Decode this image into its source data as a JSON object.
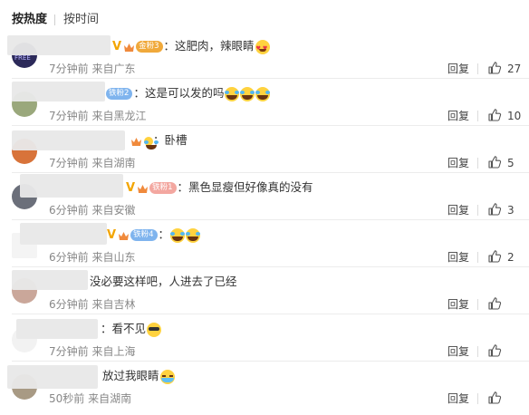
{
  "tabs": {
    "hot": "按热度",
    "time": "按时间"
  },
  "actions": {
    "reply": "回复"
  },
  "comments": [
    {
      "badge_prefix": "金粉",
      "badge_level": "3",
      "separator": "：",
      "text": "这肥肉，辣眼睛",
      "emojis": [
        "heart-eyes-emoji"
      ],
      "time": "7分钟前",
      "location": "来自广东",
      "likes": "27",
      "avatar_text": "FREE"
    },
    {
      "badge_prefix": "铁粉",
      "badge_level": "2",
      "separator": "：",
      "text": "这是可以发的吗",
      "emojis": [
        "laugh-cry-emoji",
        "laugh-cry-emoji",
        "laugh-cry-emoji"
      ],
      "time": "7分钟前",
      "location": "来自黑龙江",
      "likes": "10"
    },
    {
      "separator": "：",
      "text": "卧槽",
      "emojis": [],
      "time": "7分钟前",
      "location": "来自湖南",
      "likes": "5"
    },
    {
      "badge_prefix": "铁粉",
      "badge_level": "1",
      "separator": "：",
      "text": "黑色显瘦但好像真的没有",
      "emojis": [],
      "time": "6分钟前",
      "location": "来自安徽",
      "likes": "3"
    },
    {
      "badge_prefix": "铁粉",
      "badge_level": "4",
      "separator": "：",
      "text": "",
      "emojis": [
        "laugh-cry-emoji",
        "laugh-cry-emoji"
      ],
      "time": "6分钟前",
      "location": "来自山东",
      "likes": "2"
    },
    {
      "separator": "",
      "text": "没必要这样吧，人进去了已经",
      "emojis": [],
      "time": "6分钟前",
      "location": "来自吉林",
      "likes": ""
    },
    {
      "separator": "：",
      "text": "看不见",
      "emojis": [
        "blindfold-emoji"
      ],
      "time": "7分钟前",
      "location": "来自上海",
      "likes": ""
    },
    {
      "separator": "",
      "text": "放过我眼睛",
      "emojis": [
        "teary-emoji"
      ],
      "time": "50秒前",
      "location": "来自湖南",
      "likes": ""
    }
  ],
  "colors": {
    "vip": "#f3a500",
    "fan_badge_gold": "#f0a93b",
    "fan_badge_blue": "#7fb4ee",
    "meta_text": "#888888"
  }
}
